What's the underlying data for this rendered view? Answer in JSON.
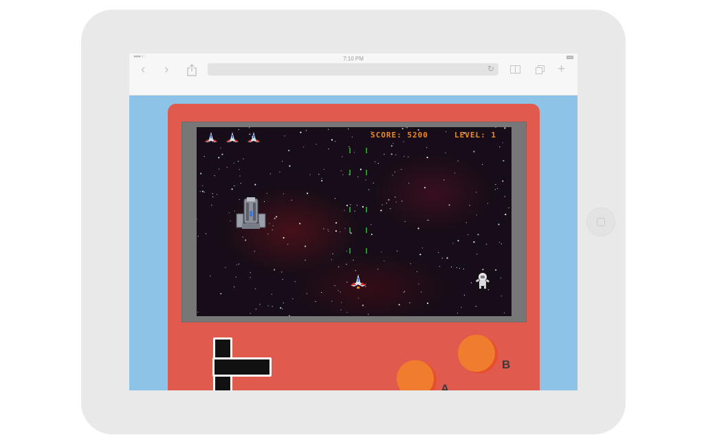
{
  "browser": {
    "status_time": "7:10 PM",
    "signal_icon": "signal-dots-icon",
    "battery_icon": "battery-icon",
    "back_icon": "back-chevron-icon",
    "forward_icon": "forward-chevron-icon",
    "share_icon": "share-icon",
    "reload_icon": "reload-icon",
    "bookmarks_icon": "bookmarks-icon",
    "tabs_icon": "tabs-icon",
    "new_tab_icon": "plus-icon",
    "url": ""
  },
  "game": {
    "score_text": "SCORE: 5200",
    "level_text": "LEVEL: 1",
    "lives": 3
  },
  "controls": {
    "a_label": "A",
    "b_label": "B"
  },
  "colors": {
    "background_blue": "#8cc3e6",
    "console_red": "#e05a4d",
    "button_orange": "#f07c2e",
    "hud_orange": "#f08a24"
  }
}
